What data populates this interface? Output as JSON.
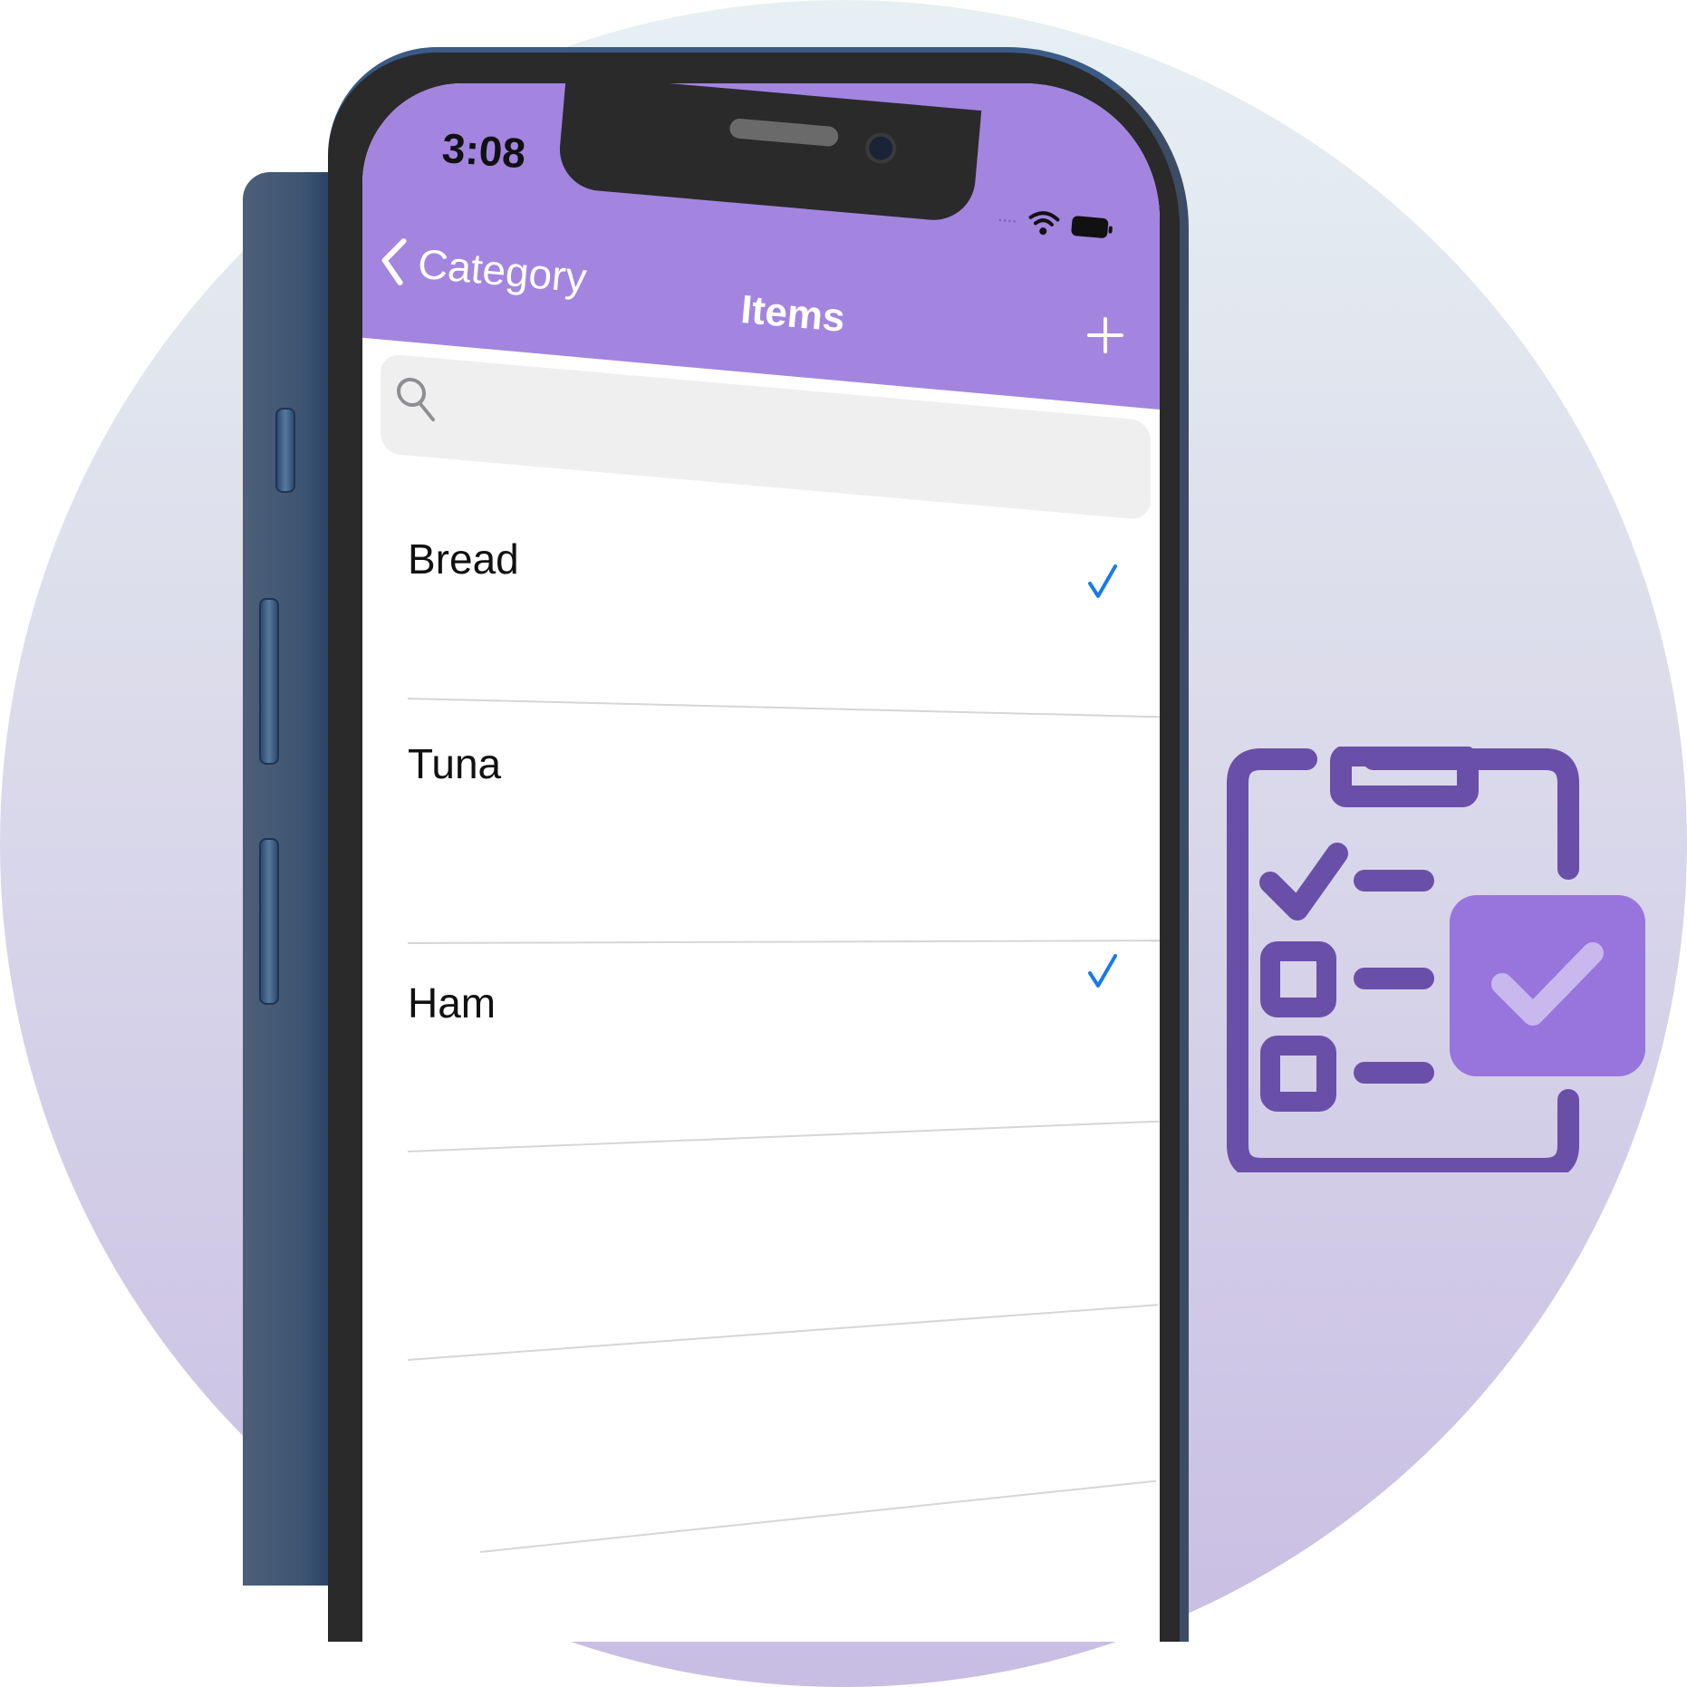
{
  "status_bar": {
    "time": "3:08",
    "icons": [
      "cellular-signal-icon",
      "wifi-icon",
      "battery-icon"
    ]
  },
  "nav_bar": {
    "back_label": "Category",
    "title": "Items",
    "add_icon": "plus-icon"
  },
  "search": {
    "placeholder": "",
    "value": ""
  },
  "items": [
    {
      "label": "Bread",
      "checked": true
    },
    {
      "label": "Tuna",
      "checked": false
    },
    {
      "label": "Ham",
      "checked": true
    }
  ],
  "colors": {
    "nav_accent": "#a385e0",
    "checkmark": "#1a7ae8",
    "clipboard_stroke": "#6a4fa8",
    "clipboard_check_box": "#9775dc"
  },
  "decoration": {
    "icon": "checklist-clipboard-icon"
  }
}
